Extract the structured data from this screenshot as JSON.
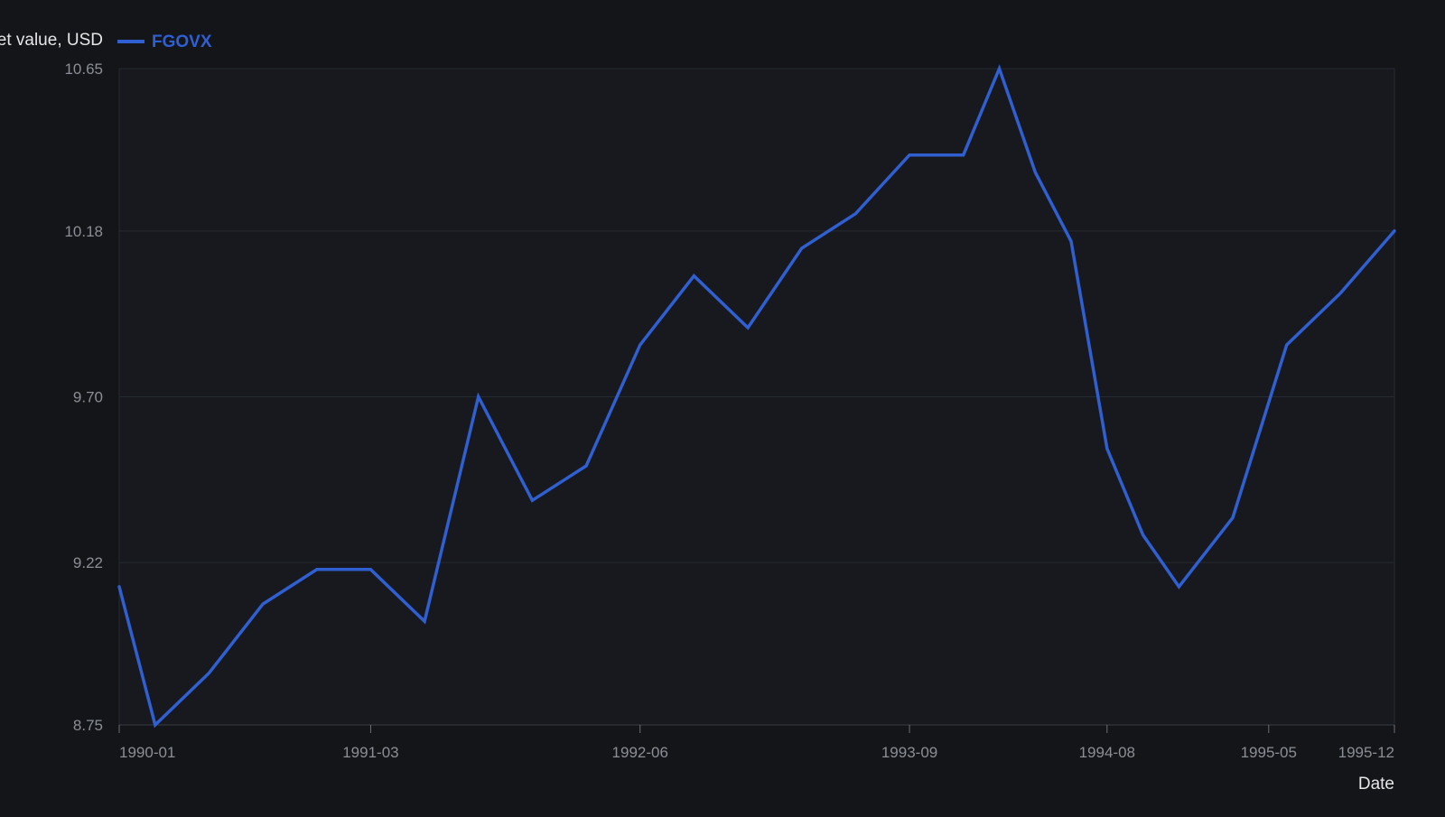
{
  "colors": {
    "page_background": "#131519",
    "plot_background": "#17191e",
    "grid": "#262a31",
    "axis_text": "#8b8e94",
    "label_text": "#e6e6e6",
    "series": "#2f5fd0"
  },
  "chart_data": {
    "type": "line",
    "title": "",
    "xlabel": "Date",
    "ylabel": "Net value, USD",
    "ylim": [
      8.75,
      10.65
    ],
    "yticks": [
      "8.75",
      "9.22",
      "9.70",
      "10.18",
      "10.65"
    ],
    "xlim": [
      "1990-01",
      "1995-12"
    ],
    "xticks": [
      "1990-01",
      "1991-03",
      "1992-06",
      "1993-09",
      "1994-08",
      "1995-05",
      "1995-12"
    ],
    "grid": true,
    "legend": "top-left",
    "series": [
      {
        "name": "FGOVX",
        "x": [
          "1990-01",
          "1990-03",
          "1990-06",
          "1990-09",
          "1990-12",
          "1991-03",
          "1991-06",
          "1991-09",
          "1991-12",
          "1992-03",
          "1992-06",
          "1992-09",
          "1992-12",
          "1993-03",
          "1993-06",
          "1993-09",
          "1993-12",
          "1994-02",
          "1994-04",
          "1994-06",
          "1994-08",
          "1994-10",
          "1994-12",
          "1995-03",
          "1995-06",
          "1995-09",
          "1995-12"
        ],
        "values": [
          9.15,
          8.75,
          8.9,
          9.1,
          9.2,
          9.2,
          9.05,
          9.7,
          9.4,
          9.5,
          9.85,
          10.05,
          9.9,
          10.13,
          10.23,
          10.4,
          10.4,
          10.65,
          10.35,
          10.15,
          9.55,
          9.3,
          9.15,
          9.35,
          9.85,
          10.0,
          10.18
        ]
      }
    ]
  }
}
